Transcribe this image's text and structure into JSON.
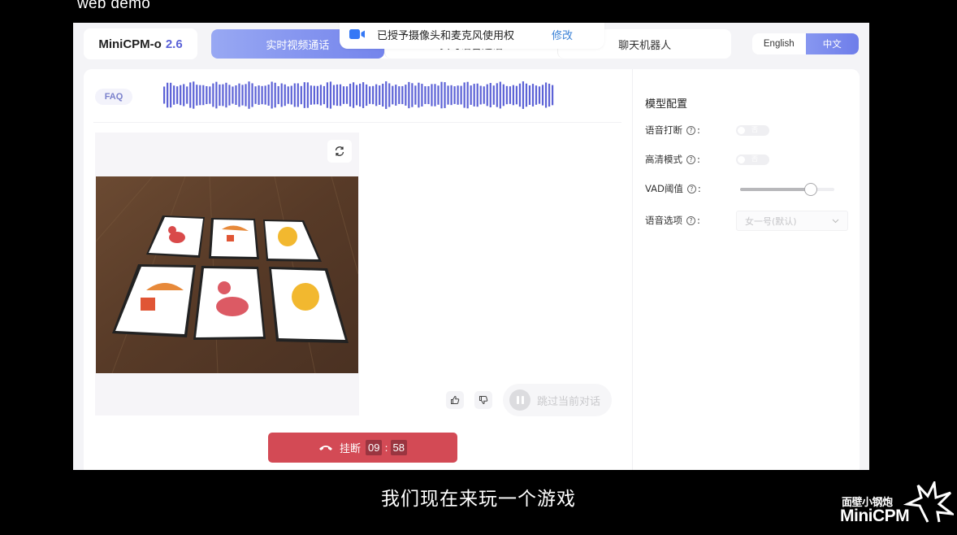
{
  "video_caption_top": "web demo",
  "header": {
    "logo_name": "MiniCPM-o",
    "logo_version": "2.6",
    "tabs": [
      {
        "label": "实时视频通话",
        "active": true
      },
      {
        "label": "实时语音通话",
        "active": false
      },
      {
        "label": "聊天机器人",
        "active": false
      }
    ],
    "language": {
      "options": [
        "English",
        "中文"
      ],
      "selected": "中文"
    }
  },
  "permission_toast": {
    "icon": "camera-icon",
    "text": "已授予摄像头和麦克风使用权",
    "edit_label": "修改"
  },
  "call_panel": {
    "faq_label": "FAQ",
    "waveform_icon": "audio-waveform",
    "refresh_icon": "refresh-icon",
    "video_scene": "Six cards on a wooden table: snake, parachute gift, grinning cat (top row); parachute gift, snake, grinning cat (bottom row)",
    "like_icon": "thumbs-up-icon",
    "dislike_icon": "thumbs-down-icon",
    "skip_label": "跳过当前对话",
    "hangup_label": "挂断",
    "timer": {
      "minutes": "09",
      "seconds": "58"
    }
  },
  "model_config": {
    "title": "模型配置",
    "voice_interrupt": {
      "label": "语音打断",
      "state": "否",
      "on": false
    },
    "hd_mode": {
      "label": "高清模式",
      "state": "否",
      "on": false
    },
    "vad_threshold": {
      "label": "VAD阈值",
      "value_fraction": 0.75
    },
    "voice_option": {
      "label": "语音选项",
      "value": "女一号(默认)"
    }
  },
  "subtitle": "我们现在来玩一个游戏",
  "watermark": {
    "cn": "面壁小钢炮",
    "en": "MiniCPM"
  }
}
